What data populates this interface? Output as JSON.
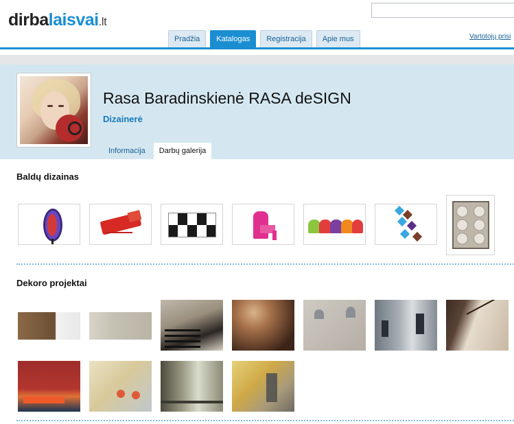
{
  "header": {
    "logo": {
      "part1": "dirba",
      "part2": "laisvai",
      "part3": ".lt"
    },
    "search": {
      "placeholder": ""
    },
    "nav_tabs": [
      {
        "label": "Pradžia",
        "active": false
      },
      {
        "label": "Katalogas",
        "active": true
      },
      {
        "label": "Registracija",
        "active": false
      },
      {
        "label": "Apie mus",
        "active": false
      }
    ],
    "user_link": "Vartotojų prisi"
  },
  "profile": {
    "name": "Rasa Baradinskienė RASA deSIGN",
    "role": "Dizainerė",
    "tabs": [
      {
        "label": "Informacija",
        "active": false
      },
      {
        "label": "Darbų galerija",
        "active": true
      }
    ]
  },
  "gallery": {
    "sections": [
      {
        "title": "Baldų dizainas",
        "item_count": 7
      },
      {
        "title": "Dekoro projektai",
        "item_count": 11
      }
    ]
  },
  "colors": {
    "brand_blue": "#1b8ed1",
    "band_background": "#d4e7f1",
    "divider": "#7cbbe2"
  }
}
